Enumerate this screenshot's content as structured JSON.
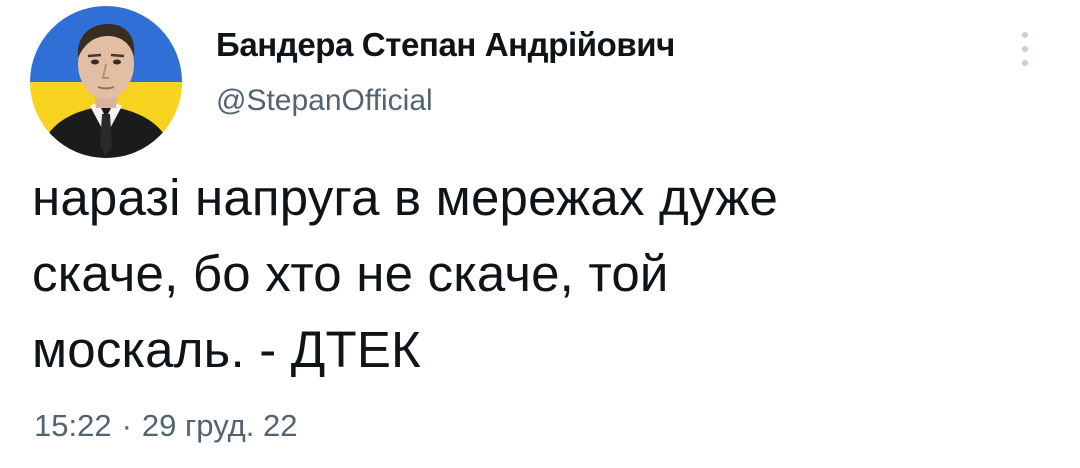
{
  "author": {
    "display_name": "Бандера Степан Андрійович",
    "handle": "@StepanOfficial"
  },
  "avatar": {
    "icon": "portrait-avatar",
    "flag_colors": [
      "#2f6fd6",
      "#f7d21e"
    ]
  },
  "menu": {
    "icon": "more-vertical-icon"
  },
  "tweet": {
    "lines": [
      "наразі напруга в мережах дуже",
      "скаче, бо хто не скаче, той",
      "москаль. - ДТЕК"
    ]
  },
  "meta": {
    "time": "15:22",
    "separator": "·",
    "date": "29 груд. 22"
  }
}
